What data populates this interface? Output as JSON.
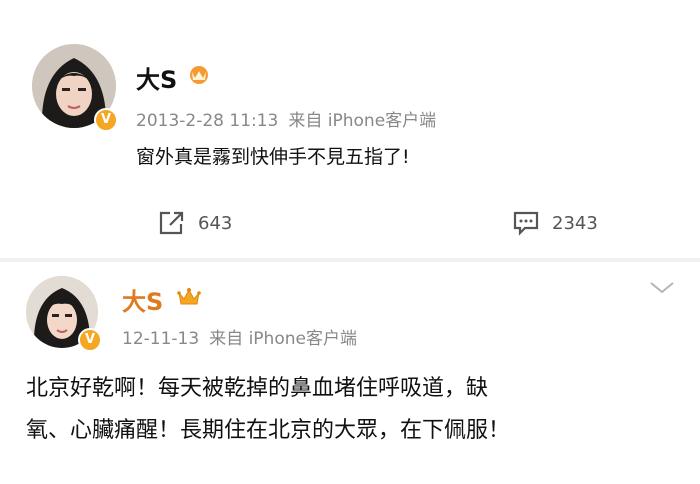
{
  "post1": {
    "user_name": "大S",
    "timestamp": "2013-2-28 11:13",
    "source": "来自 iPhone客户端",
    "text": "窗外真是霧到快伸手不見五指了!",
    "repost_count": "643",
    "comment_count": "2343"
  },
  "post2": {
    "user_name": "大S",
    "timestamp": "12-11-13",
    "source": "来自 iPhone客户端",
    "text_line1": "北京好乾啊！每天被乾掉的鼻血堵住呼吸道，缺",
    "text_line2": "氧、心臟痛醒！長期住在北京的大眾，在下佩服！"
  },
  "colors": {
    "verified_badge": "#f5a623",
    "meta_text": "#888888",
    "separator": "#f0f0f0"
  },
  "icons": [
    "verified-icon",
    "crown-icon",
    "repost-icon",
    "comment-icon",
    "chevron-down-icon"
  ]
}
